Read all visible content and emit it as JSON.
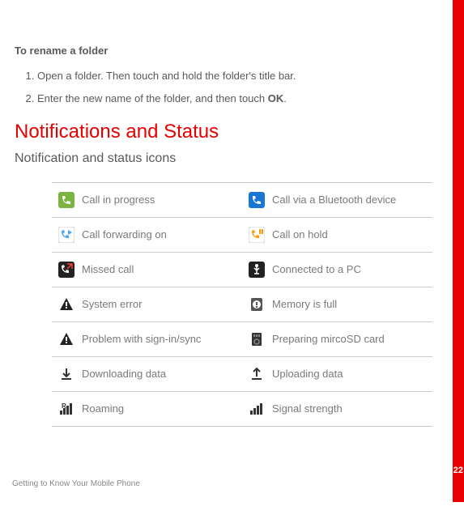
{
  "section1_title": "To rename a folder",
  "step1": "Open a folder. Then touch and hold the folder's title bar.",
  "step2_part1": "Enter the new name of the folder, and then touch ",
  "step2_ok": "OK",
  "step2_part2": ".",
  "heading_main": "Notifications and Status",
  "heading_sub": "Notification and status icons",
  "icons": {
    "r0c0": "Call in progress",
    "r0c1": "Call via a Bluetooth device",
    "r1c0": "Call forwarding on",
    "r1c1": "Call on hold",
    "r2c0": "Missed call",
    "r2c1": "Connected to a PC",
    "r3c0": "System error",
    "r3c1": "Memory is full",
    "r4c0": "Problem with sign-in/sync",
    "r4c1": "Preparing mircoSD card",
    "r5c0": "Downloading data",
    "r5c1": "Uploading data",
    "r6c0": "Roaming",
    "r6c1": "Signal strength"
  },
  "footer": "Getting to Know Your Mobile Phone",
  "page_number": "22"
}
